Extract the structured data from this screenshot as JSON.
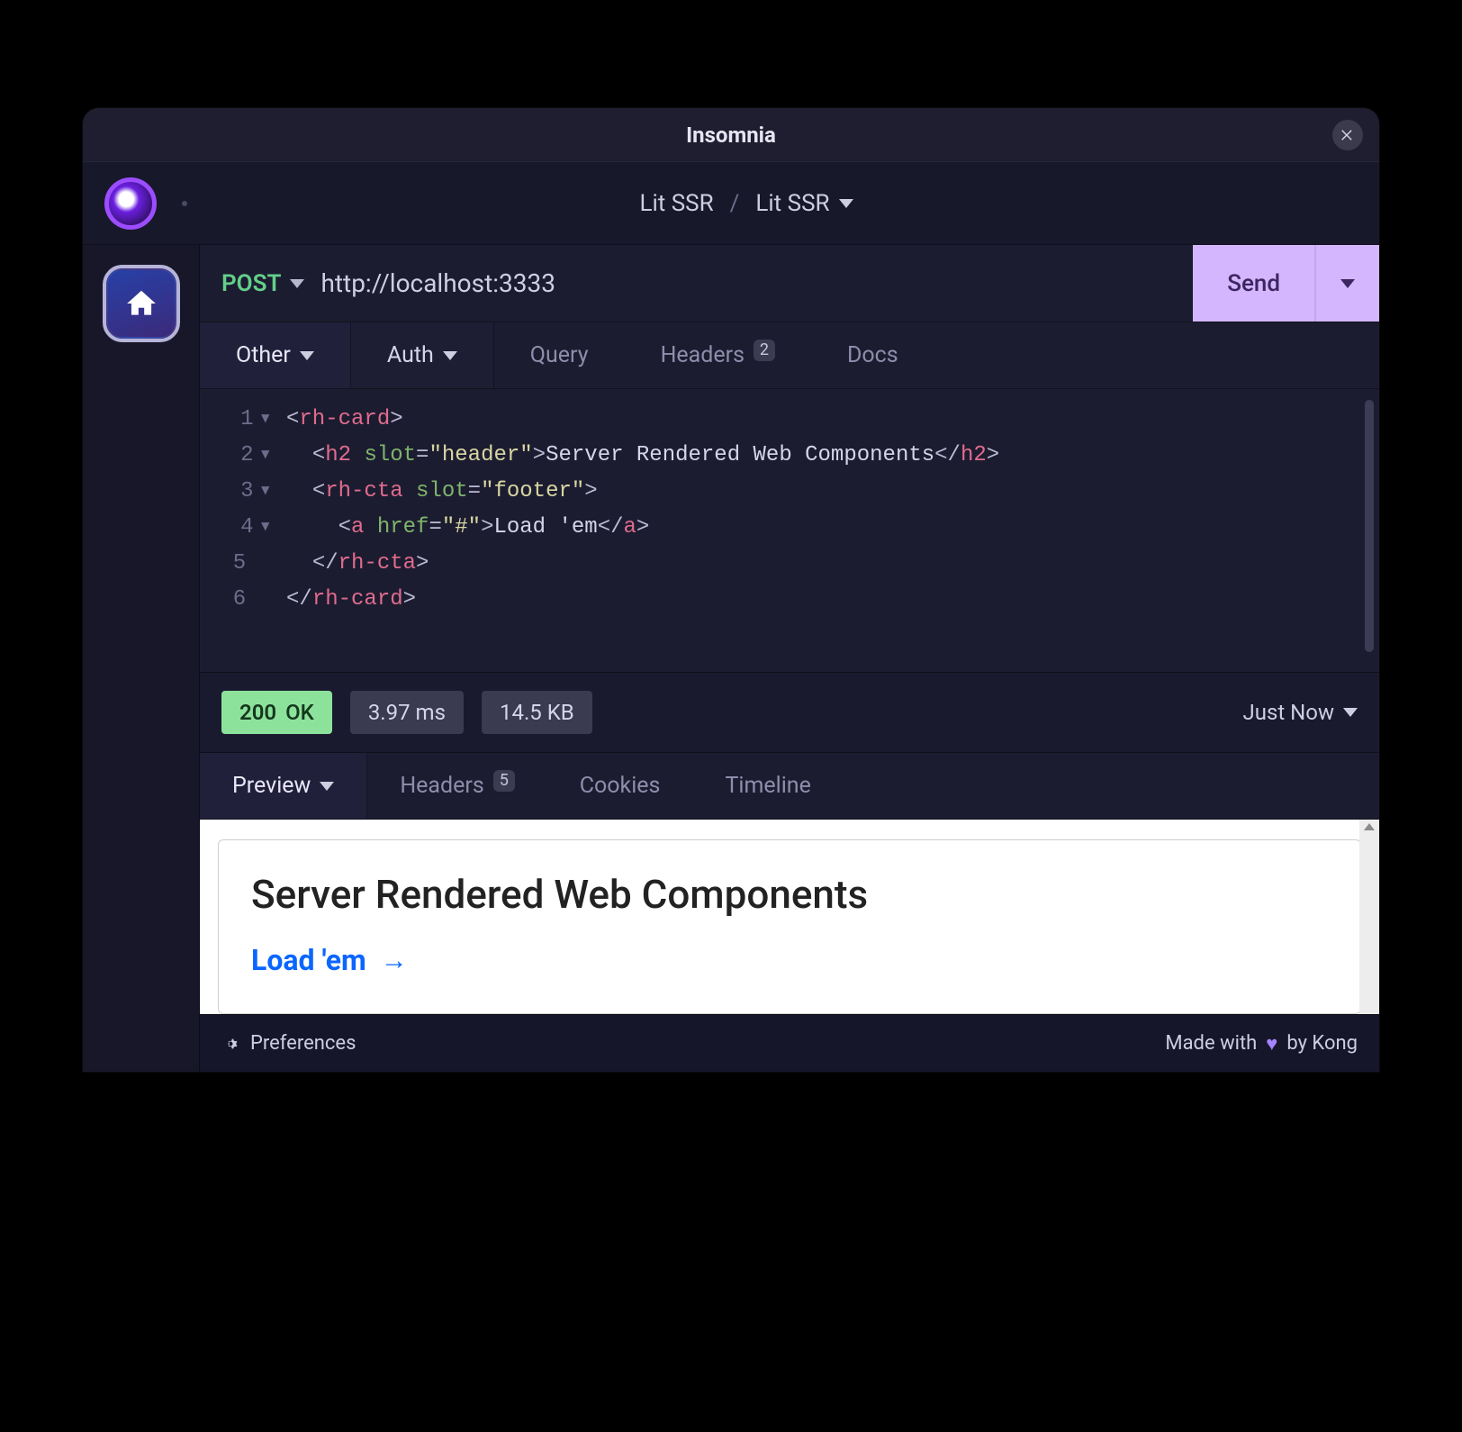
{
  "window": {
    "title": "Insomnia"
  },
  "breadcrumb": {
    "workspace": "Lit SSR",
    "collection": "Lit SSR"
  },
  "request": {
    "method": "POST",
    "url": "http://localhost:3333",
    "send_label": "Send",
    "tabs": {
      "body": "Other",
      "auth": "Auth",
      "query": "Query",
      "headers": "Headers",
      "headers_count": "2",
      "docs": "Docs"
    },
    "body_lines": [
      {
        "n": "1",
        "foldable": true,
        "html": "<span class='t-punc'>&lt;</span><span class='t-tag'>rh-card</span><span class='t-punc'>&gt;</span>"
      },
      {
        "n": "2",
        "foldable": true,
        "html": "  <span class='t-punc'>&lt;</span><span class='t-tag'>h2</span> <span class='t-attr'>slot</span><span class='t-punc'>=</span><span class='t-str'>\"header\"</span><span class='t-punc'>&gt;</span><span class='t-text'>Server Rendered Web Components</span><span class='t-punc'>&lt;/</span><span class='t-tag'>h2</span><span class='t-punc'>&gt;</span>"
      },
      {
        "n": "3",
        "foldable": true,
        "html": "  <span class='t-punc'>&lt;</span><span class='t-tag'>rh-cta</span> <span class='t-attr'>slot</span><span class='t-punc'>=</span><span class='t-str'>\"footer\"</span><span class='t-punc'>&gt;</span>"
      },
      {
        "n": "4",
        "foldable": true,
        "html": "    <span class='t-punc'>&lt;</span><span class='t-tag'>a</span> <span class='t-attr'>href</span><span class='t-punc'>=</span><span class='t-str'>\"#\"</span><span class='t-punc'>&gt;</span><span class='t-text'>Load 'em</span><span class='t-punc'>&lt;/</span><span class='t-tag'>a</span><span class='t-punc'>&gt;</span>"
      },
      {
        "n": "5",
        "foldable": false,
        "html": "  <span class='t-punc'>&lt;/</span><span class='t-tag'>rh-cta</span><span class='t-punc'>&gt;</span>"
      },
      {
        "n": "6",
        "foldable": false,
        "html": "<span class='t-punc'>&lt;/</span><span class='t-tag'>rh-card</span><span class='t-punc'>&gt;</span>"
      }
    ]
  },
  "response": {
    "status_code": "200",
    "status_text": "OK",
    "time": "3.97 ms",
    "size": "14.5 KB",
    "history_label": "Just Now",
    "tabs": {
      "preview": "Preview",
      "headers": "Headers",
      "headers_count": "5",
      "cookies": "Cookies",
      "timeline": "Timeline"
    },
    "preview": {
      "heading": "Server Rendered Web Components",
      "cta_label": "Load 'em"
    }
  },
  "footer": {
    "preferences": "Preferences",
    "made_with_pre": "Made with",
    "made_with_post": "by Kong"
  }
}
